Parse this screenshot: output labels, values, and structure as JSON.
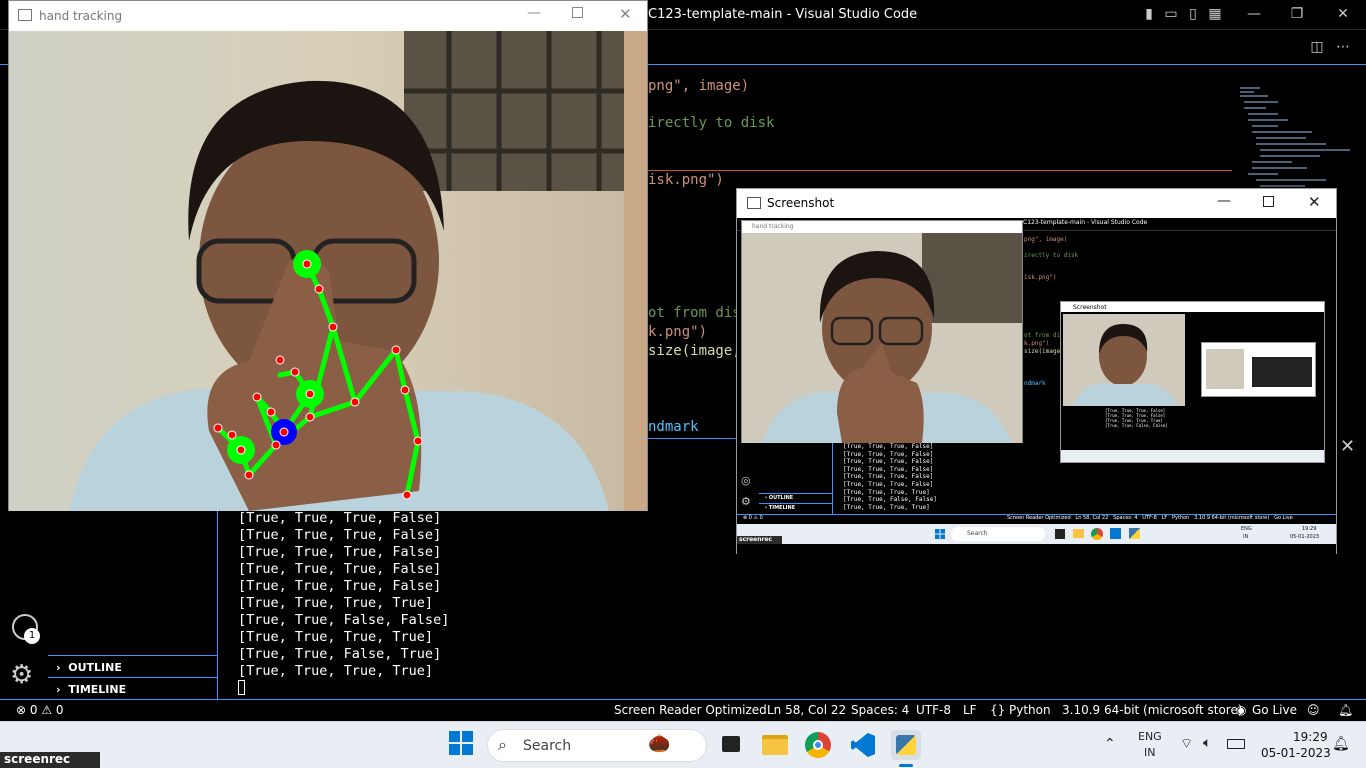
{
  "vscode": {
    "title": "C123-template-main - Visual Studio Code",
    "code_fragments": {
      "l1": "png\", image)",
      "l2": "irectly to disk",
      "l3": "isk.png\")",
      "l4": "ot from disk",
      "l5": "k.png\")",
      "l6": "size(image,",
      "l7": "ndmark"
    },
    "terminal_lines": [
      "[True, True, True, False]",
      "[True, True, True, False]",
      "[True, True, True, False]",
      "[True, True, True, False]",
      "[True, True, True, False]",
      "[True, True, True, True]",
      "[True, True, False, False]",
      "[True, True, True, True]",
      "[True, True, False, True]",
      "[True, True, True, True]"
    ],
    "sidebar": {
      "outline": "OUTLINE",
      "timeline": "TIMELINE",
      "accounts_badge": "1"
    },
    "status_bar": {
      "errors": "0",
      "warnings": "0",
      "screen_reader": "Screen Reader Optimized",
      "position": "Ln 58, Col 22",
      "spaces": "Spaces: 4",
      "encoding": "UTF-8",
      "eol": "LF",
      "language": "Python",
      "interpreter": "3.10.9 64-bit (microsoft store)",
      "go_live": "Go Live"
    }
  },
  "hand_window": {
    "title": "hand tracking"
  },
  "screenshot_window": {
    "title": "Screenshot",
    "nested": {
      "hand_title": "hand tracking",
      "vsc_title": "C123-template-main - Visual Studio Code",
      "inner_title": "Screenshot",
      "terminal_lines": [
        "[True, True, True, False]",
        "[True, True, True, False]",
        "[True, True, True, False]",
        "[True, True, True, False]",
        "[True, True, True, False]",
        "[True, True, True, False]",
        "[True, True, True, True]",
        "[True, True, False, False]",
        "[True, True, True, True]"
      ],
      "outline": "OUTLINE",
      "timeline": "TIMELINE",
      "status": "Screen Reader Optimized   Ln 58, Col 22   Spaces: 4   UTF-8   LF   Python   3.10.9 64-bit (microsoft store)   Go Live",
      "search": "Search",
      "time": "19:29",
      "date": "05-01-2023",
      "lang": "ENG",
      "region": "IN",
      "rec": "screenrec"
    }
  },
  "taskbar": {
    "search_label": "Search",
    "lang": "ENG",
    "region": "IN",
    "time": "19:29",
    "date": "05-01-2023"
  },
  "screenrec_label": "screenrec",
  "colors": {
    "landmark_line": "#00ff00",
    "landmark_point": "#ff0000",
    "accent": "#3794ff",
    "index_tip": "#0000ff"
  }
}
